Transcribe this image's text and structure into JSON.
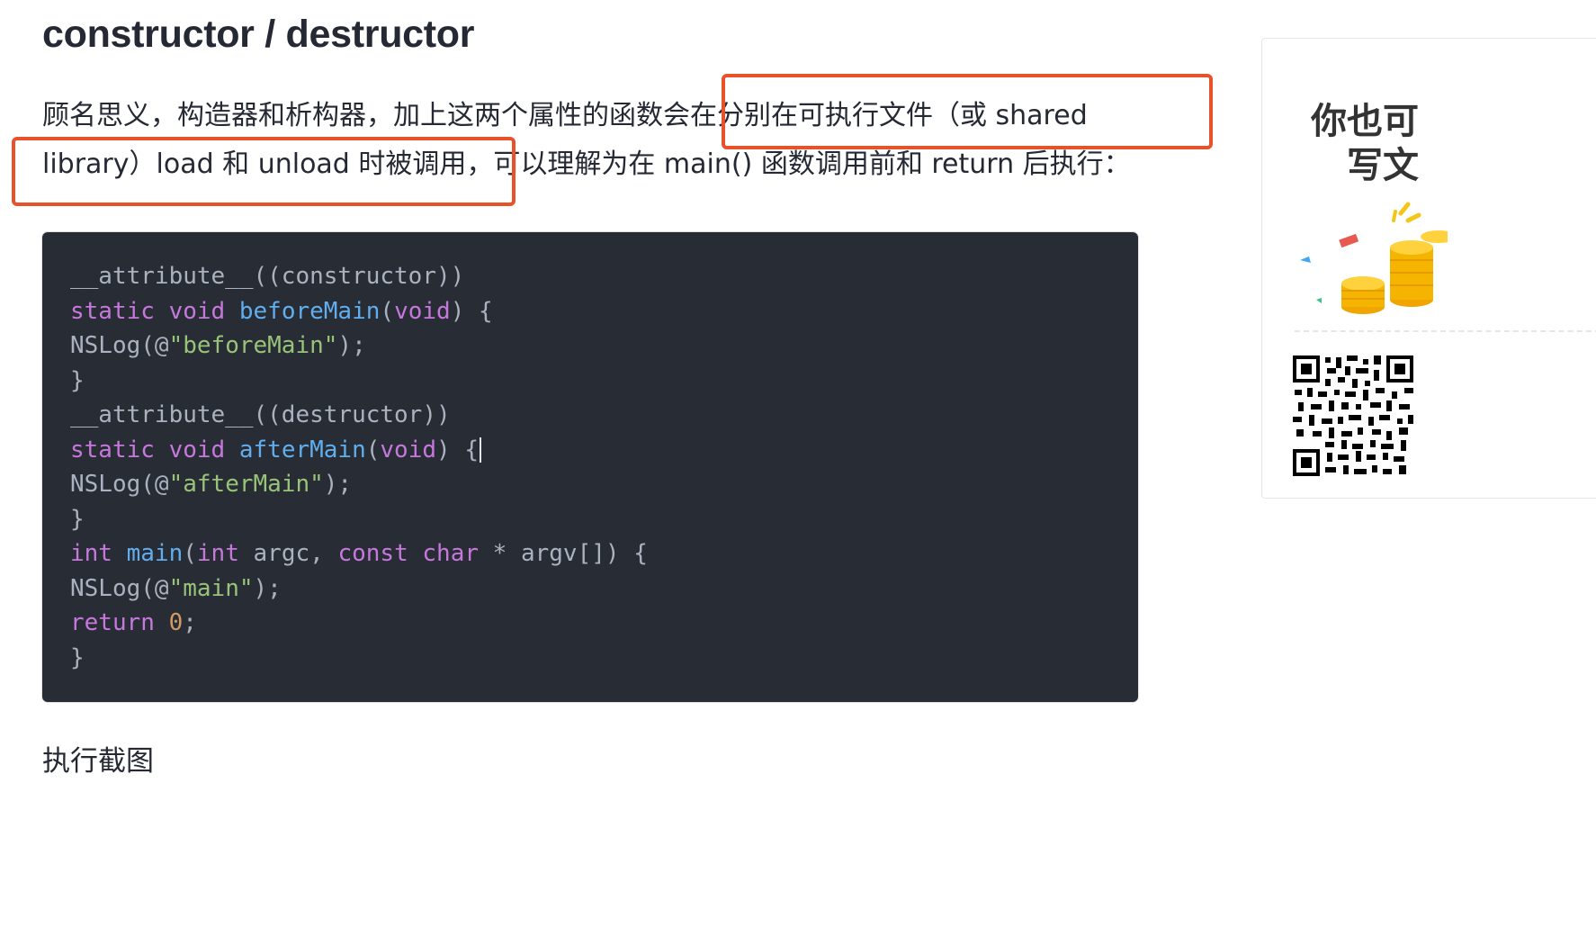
{
  "article": {
    "title": "constructor / destructor",
    "paragraph_lines": [
      "顾名思义，构造器和析构器，加上这两个属性的函数会在分别在可执行文件（或 shared",
      "library）load 和 unload 时被调用，可以理解为在 main() 函数调用前和 return 后执行："
    ],
    "subheading": "执行截图"
  },
  "code": {
    "language": "objective-c",
    "lines": [
      "__attribute__((constructor))",
      "static void beforeMain(void) {",
      "NSLog(@\"beforeMain\");",
      "}",
      "__attribute__((destructor))",
      "static void afterMain(void) {",
      "NSLog(@\"afterMain\");",
      "}",
      "int main(int argc, const char * argv[]) {",
      "NSLog(@\"main\");",
      "return 0;",
      "}"
    ]
  },
  "sidebar_ad": {
    "title_line1": "你也可",
    "title_line2": "写文",
    "icon": "coins-illustration",
    "qr_icon": "qr-code-icon"
  },
  "colors": {
    "text": "#252933",
    "annotation_red": "#e8522b",
    "code_background": "#282c34",
    "code_keyword": "#c678dd",
    "code_function": "#61aeee",
    "code_string": "#98c379",
    "code_number": "#d19a66",
    "code_plain": "#abb2bf"
  }
}
